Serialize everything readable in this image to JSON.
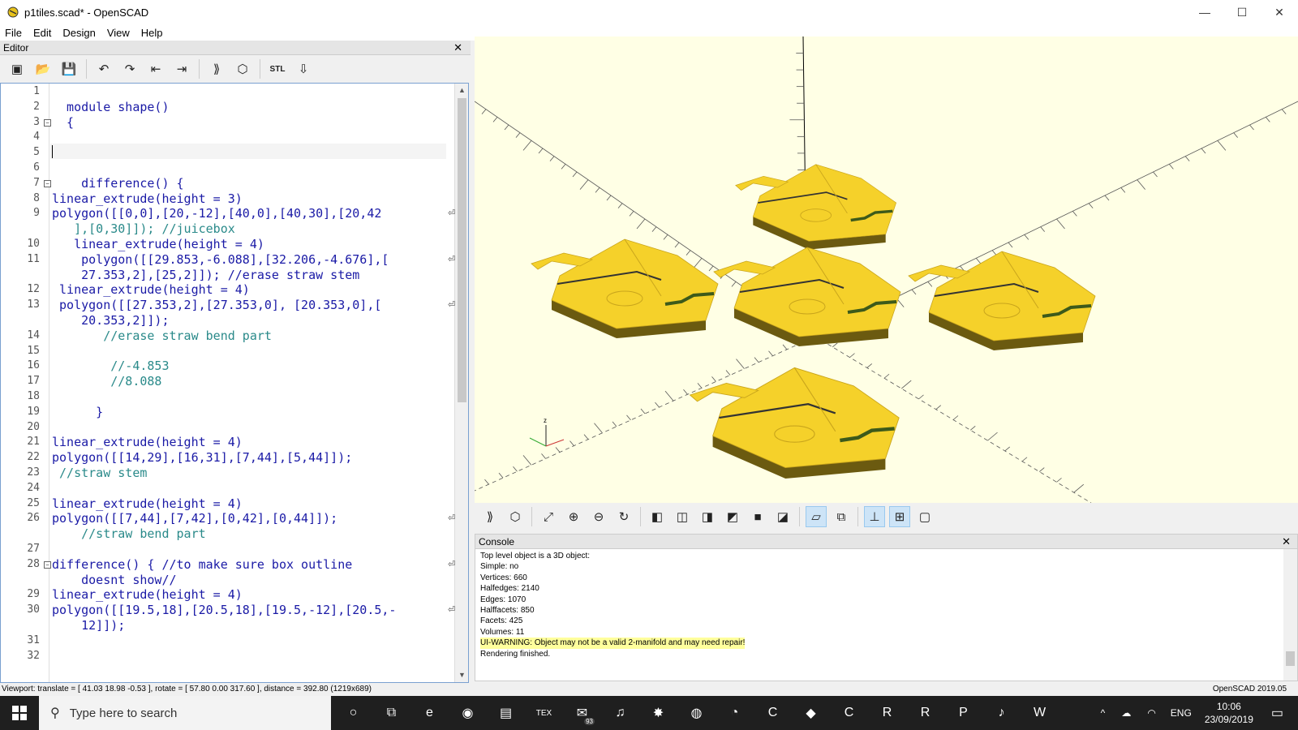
{
  "window": {
    "title": "p1tiles.scad* - OpenSCAD",
    "minimize_glyph": "—",
    "maximize_glyph": "☐",
    "close_glyph": "✕"
  },
  "menu": [
    "File",
    "Edit",
    "Design",
    "View",
    "Help"
  ],
  "editor": {
    "title": "Editor",
    "close_glyph": "✕",
    "toolbar": [
      {
        "name": "new-file-icon",
        "glyph": "▣"
      },
      {
        "name": "open-file-icon",
        "glyph": "📂"
      },
      {
        "name": "save-icon",
        "glyph": "💾"
      },
      {
        "name": "undo-icon",
        "glyph": "↶"
      },
      {
        "name": "redo-icon",
        "glyph": "↷"
      },
      {
        "name": "unindent-icon",
        "glyph": "⇤"
      },
      {
        "name": "indent-icon",
        "glyph": "⇥"
      },
      {
        "name": "preview-icon",
        "glyph": "⟫"
      },
      {
        "name": "render-icon",
        "glyph": "⬡"
      },
      {
        "name": "export-stl-icon",
        "glyph": "STL"
      },
      {
        "name": "send-to-print-icon",
        "glyph": "⇩"
      }
    ],
    "lines": [
      {
        "n": "1",
        "text": ""
      },
      {
        "n": "2",
        "text": "  module shape()"
      },
      {
        "n": "3",
        "text": "  {",
        "fold": true
      },
      {
        "n": "4",
        "text": ""
      },
      {
        "n": "5",
        "text": ""
      },
      {
        "n": "6",
        "text": ""
      },
      {
        "n": "7",
        "text": "    difference() {",
        "fold": true
      },
      {
        "n": "8",
        "text": "linear_extrude(height = 3)"
      },
      {
        "n": "9",
        "text": "polygon([[0,0],[20,-12],[40,0],[40,30],[20,42",
        "wrap": true
      },
      {
        "n": "",
        "text": "   ],[0,30]]); //juicebox"
      },
      {
        "n": "10",
        "text": "   linear_extrude(height = 4)"
      },
      {
        "n": "11",
        "text": "    polygon([[29.853,-6.088],[32.206,-4.676],[",
        "wrap": true
      },
      {
        "n": "",
        "text": "    27.353,2],[25,2]]); //erase straw stem"
      },
      {
        "n": "12",
        "text": " linear_extrude(height = 4)"
      },
      {
        "n": "13",
        "text": " polygon([[27.353,2],[27.353,0], [20.353,0],[",
        "wrap": true
      },
      {
        "n": "",
        "text": "    20.353,2]]);"
      },
      {
        "n": "14",
        "text": "       //erase straw bend part"
      },
      {
        "n": "15",
        "text": ""
      },
      {
        "n": "16",
        "text": "        //-4.853"
      },
      {
        "n": "17",
        "text": "        //8.088"
      },
      {
        "n": "18",
        "text": ""
      },
      {
        "n": "19",
        "text": "      }"
      },
      {
        "n": "20",
        "text": ""
      },
      {
        "n": "21",
        "text": "linear_extrude(height = 4)"
      },
      {
        "n": "22",
        "text": "polygon([[14,29],[16,31],[7,44],[5,44]]);"
      },
      {
        "n": "23",
        "text": " //straw stem"
      },
      {
        "n": "24",
        "text": ""
      },
      {
        "n": "25",
        "text": "linear_extrude(height = 4)"
      },
      {
        "n": "26",
        "text": "polygon([[7,44],[7,42],[0,42],[0,44]]);",
        "wrap": true
      },
      {
        "n": "",
        "text": "    //straw bend part"
      },
      {
        "n": "27",
        "text": ""
      },
      {
        "n": "28",
        "text": "difference() { //to make sure box outline",
        "fold": true,
        "wrap": true
      },
      {
        "n": "",
        "text": "    doesnt show//"
      },
      {
        "n": "29",
        "text": "linear_extrude(height = 4)"
      },
      {
        "n": "30",
        "text": "polygon([[19.5,18],[20.5,18],[19.5,-12],[20.5,-",
        "wrap": true
      },
      {
        "n": "",
        "text": "    12]]);"
      },
      {
        "n": "31",
        "text": ""
      },
      {
        "n": "32",
        "text": ""
      }
    ]
  },
  "viewport": {
    "axis_label_z": "z",
    "background": "#ffffe5",
    "tile_color": "#f5d12a",
    "tile_side_color": "#6b5a10",
    "tiles": 5
  },
  "view_toolbar": [
    {
      "name": "preview-view-icon",
      "glyph": "⟫"
    },
    {
      "name": "render-view-icon",
      "glyph": "⬡"
    },
    {
      "name": "view-all-icon",
      "glyph": "⤢"
    },
    {
      "name": "zoom-in-icon",
      "glyph": "⊕"
    },
    {
      "name": "zoom-out-icon",
      "glyph": "⊖"
    },
    {
      "name": "reset-view-icon",
      "glyph": "↻"
    },
    {
      "name": "view-right-icon",
      "glyph": "◧"
    },
    {
      "name": "view-top-icon",
      "glyph": "◫"
    },
    {
      "name": "view-bottom-icon",
      "glyph": "◨"
    },
    {
      "name": "view-left-icon",
      "glyph": "◩"
    },
    {
      "name": "view-front-icon",
      "glyph": "■"
    },
    {
      "name": "view-back-icon",
      "glyph": "◪"
    },
    {
      "name": "perspective-icon",
      "glyph": "▱",
      "active": true
    },
    {
      "name": "orthogonal-icon",
      "glyph": "⧉"
    },
    {
      "name": "show-axes-icon",
      "glyph": "⊥",
      "active": true
    },
    {
      "name": "show-scale-icon",
      "glyph": "⊞",
      "active": true
    },
    {
      "name": "show-edges-icon",
      "glyph": "▢"
    }
  ],
  "console": {
    "title": "Console",
    "close_glyph": "✕",
    "lines": [
      {
        "text": "Top level object is a 3D object:"
      },
      {
        "text": "Simple: no"
      },
      {
        "text": "Vertices: 660"
      },
      {
        "text": "Halfedges: 2140"
      },
      {
        "text": "Edges: 1070"
      },
      {
        "text": "Halffacets: 850"
      },
      {
        "text": "Facets: 425"
      },
      {
        "text": "Volumes: 11"
      },
      {
        "text": "UI-WARNING: Object may not be a valid 2-manifold and may need repair!",
        "warn": true
      },
      {
        "text": "Rendering finished."
      }
    ]
  },
  "status": {
    "viewport": "Viewport: translate = [ 41.03 18.98 -0.53 ], rotate = [ 57.80 0.00 317.60 ], distance = 392.80 (1219x689)",
    "version": "OpenSCAD 2019.05"
  },
  "taskbar": {
    "search_placeholder": "Type here to search",
    "apps": [
      {
        "name": "cortana-icon",
        "glyph": "○"
      },
      {
        "name": "task-view-icon",
        "glyph": "⧉"
      },
      {
        "name": "edge-icon",
        "glyph": "e"
      },
      {
        "name": "chrome-icon",
        "glyph": "◉"
      },
      {
        "name": "file-explorer-icon",
        "glyph": "▤"
      },
      {
        "name": "tex-icon",
        "glyph": "TEX"
      },
      {
        "name": "email-icon",
        "glyph": "✉",
        "badge": "93"
      },
      {
        "name": "spotify-icon",
        "glyph": "♫"
      },
      {
        "name": "app-red-icon",
        "glyph": "✸"
      },
      {
        "name": "openscad-icon",
        "glyph": "◍"
      },
      {
        "name": "inkscape-icon",
        "glyph": "◔"
      },
      {
        "name": "c-app-icon",
        "glyph": "C"
      },
      {
        "name": "gem-app-icon",
        "glyph": "◆"
      },
      {
        "name": "camtasia-icon",
        "glyph": "C"
      },
      {
        "name": "rstudio-icon",
        "glyph": "R"
      },
      {
        "name": "r-icon",
        "glyph": "R"
      },
      {
        "name": "powerpoint-icon",
        "glyph": "P"
      },
      {
        "name": "itunes-icon",
        "glyph": "♪"
      },
      {
        "name": "word-icon",
        "glyph": "W"
      }
    ],
    "tray": {
      "up_glyph": "^",
      "cloud_glyph": "☁",
      "wifi_glyph": "◠",
      "language": "ENG",
      "time": "10:06",
      "date": "23/09/2019",
      "notify_glyph": "▭"
    }
  }
}
